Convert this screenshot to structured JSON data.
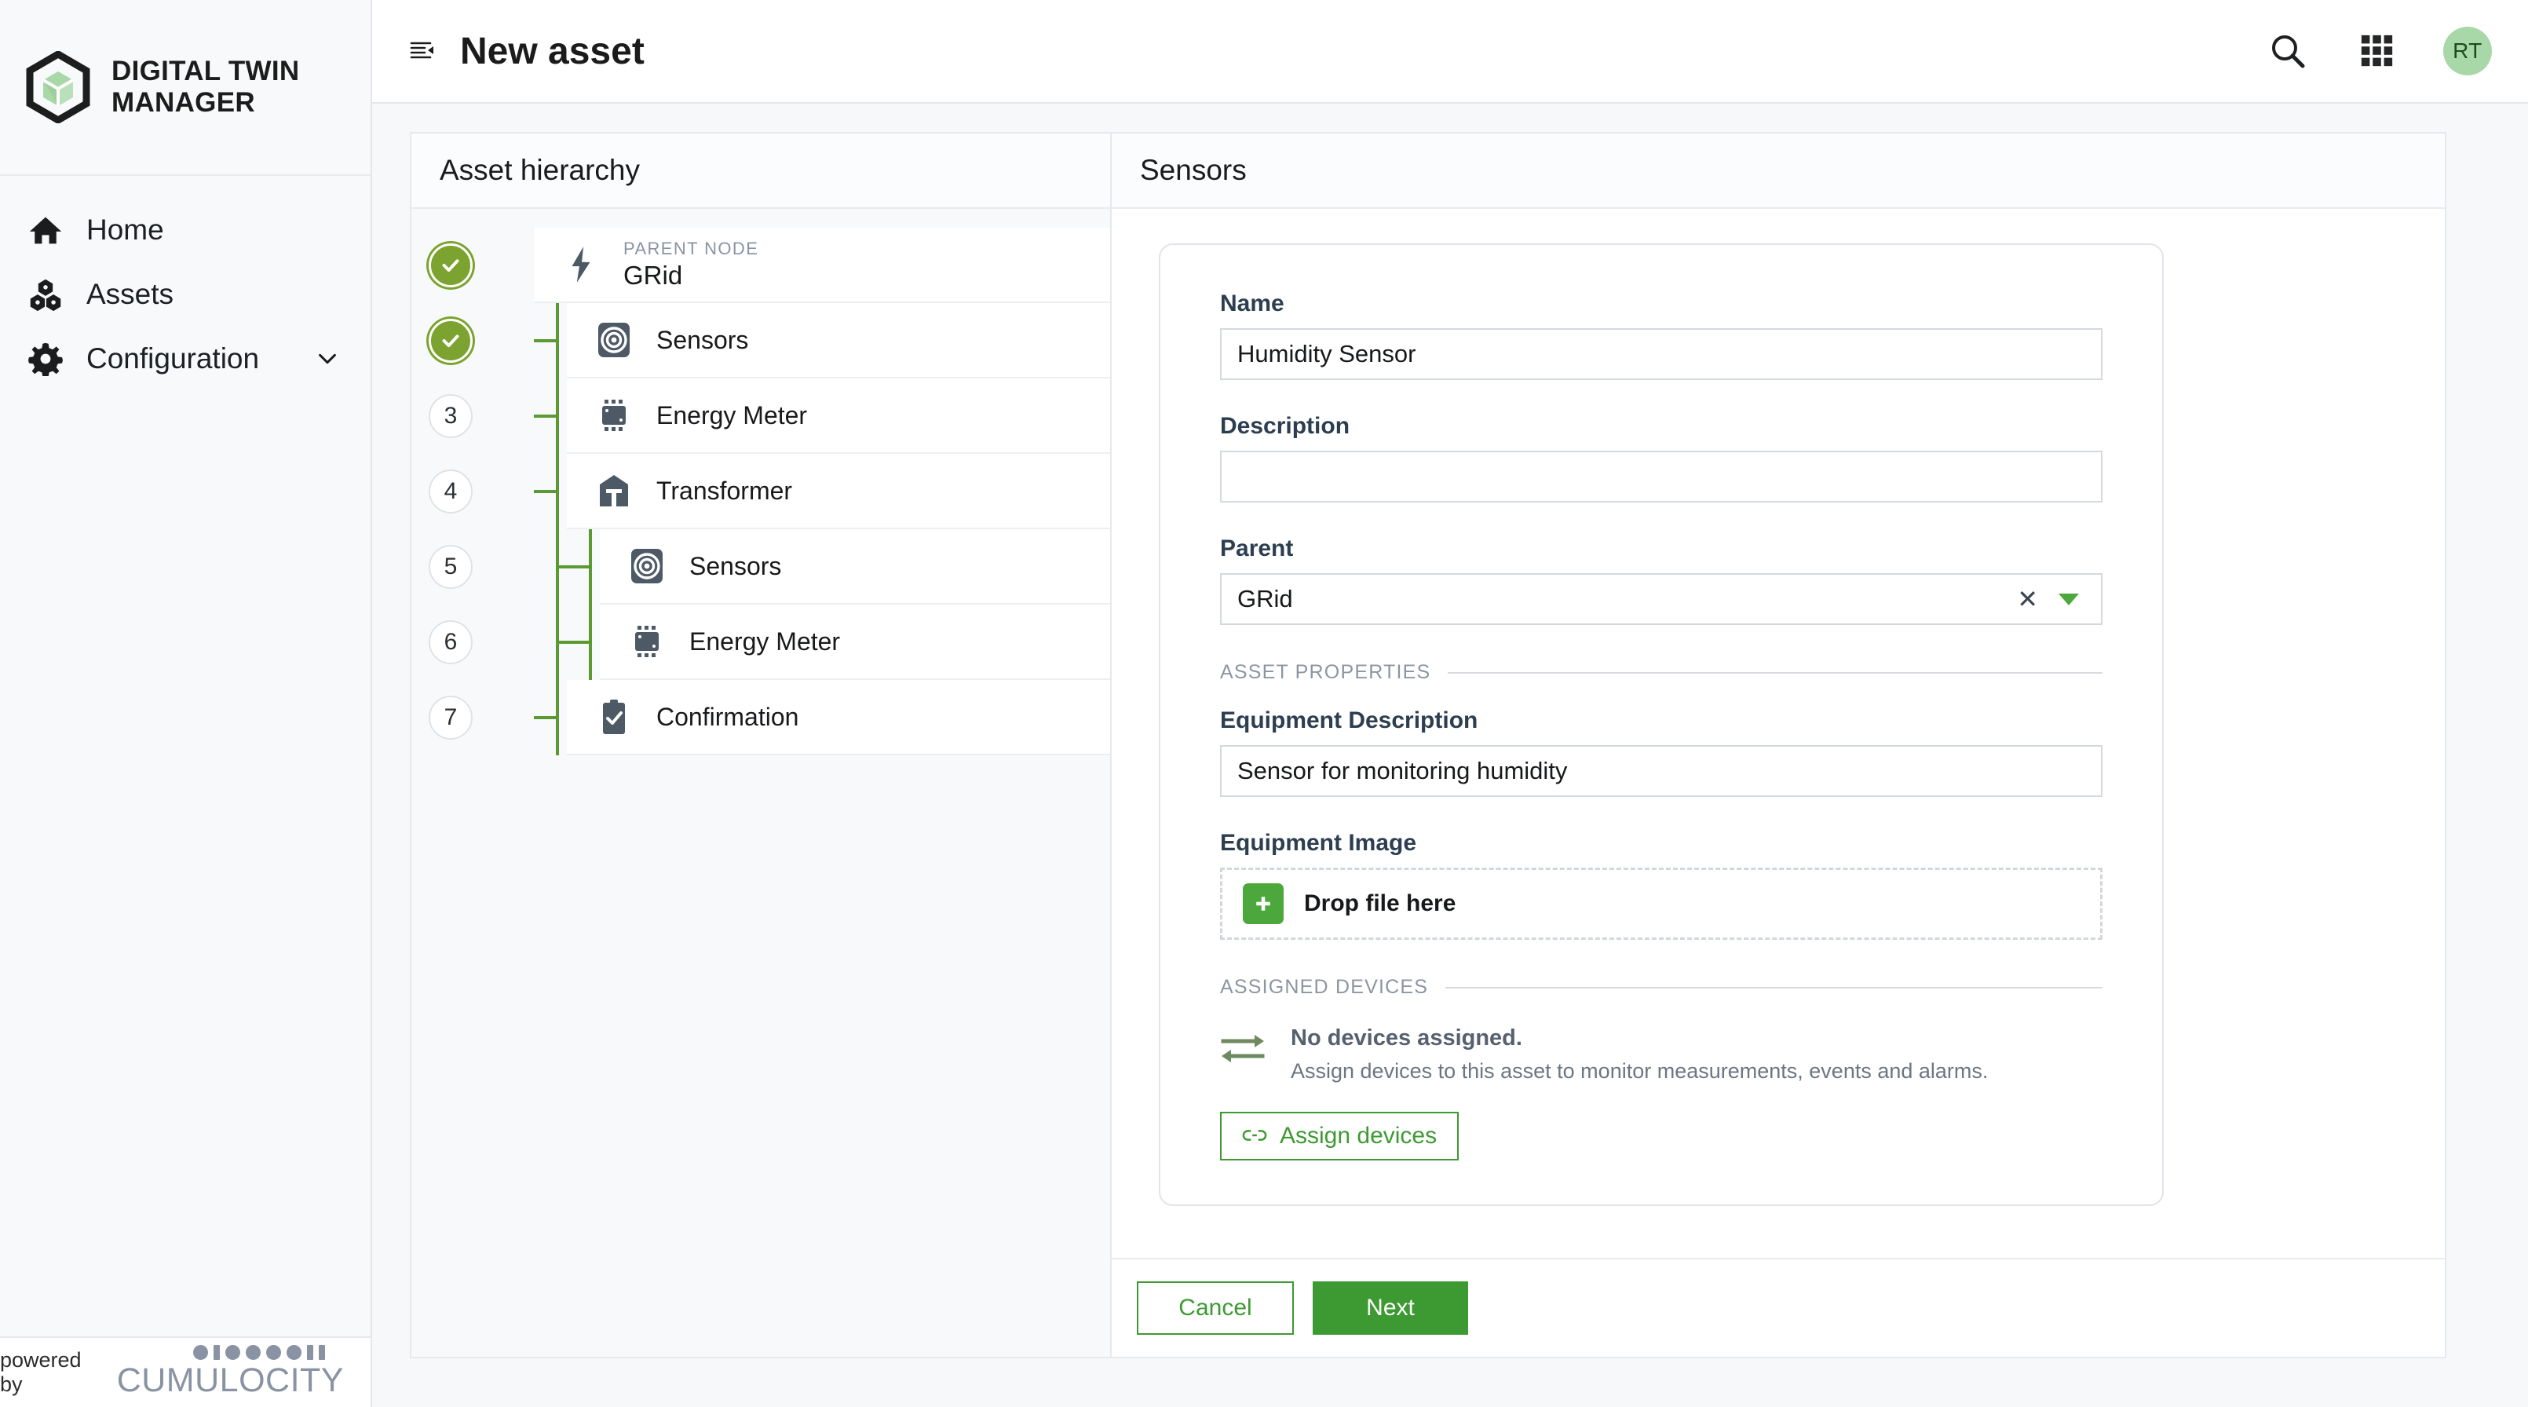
{
  "brand": {
    "line1": "DIGITAL TWIN",
    "line2": "MANAGER",
    "logo_icon": "cube-hexagon-logo"
  },
  "sidebar": {
    "items": [
      {
        "label": "Home",
        "icon": "home-icon"
      },
      {
        "label": "Assets",
        "icon": "cubes-icon"
      },
      {
        "label": "Configuration",
        "icon": "gear-icon",
        "caret": "chevron-down-icon"
      }
    ],
    "footer": {
      "powered_by": "powered by",
      "product": "CUMULOCITY"
    }
  },
  "topbar": {
    "menu_icon": "collapse-menu-icon",
    "title": "New asset",
    "search_icon": "search-icon",
    "apps_icon": "app-grid-icon",
    "avatar_initials": "RT"
  },
  "hierarchy": {
    "title": "Asset hierarchy",
    "nodes": [
      {
        "step": "1",
        "done": true,
        "indent": 0,
        "icon": "bolt-icon",
        "tag": "PARENT NODE",
        "label": "GRid"
      },
      {
        "step": "2",
        "done": true,
        "indent": 0,
        "icon": "target-icon",
        "tag": "",
        "label": "Sensors"
      },
      {
        "step": "3",
        "done": false,
        "indent": 0,
        "icon": "microchip-icon",
        "tag": "",
        "label": "Energy Meter"
      },
      {
        "step": "4",
        "done": false,
        "indent": 0,
        "icon": "transformer-icon",
        "tag": "",
        "label": "Transformer"
      },
      {
        "step": "5",
        "done": false,
        "indent": 1,
        "icon": "target-icon",
        "tag": "",
        "label": "Sensors"
      },
      {
        "step": "6",
        "done": false,
        "indent": 1,
        "icon": "microchip-icon",
        "tag": "",
        "label": "Energy Meter"
      },
      {
        "step": "7",
        "done": false,
        "indent": 0,
        "icon": "clipboard-check-icon",
        "tag": "",
        "label": "Confirmation"
      }
    ]
  },
  "form": {
    "title": "Sensors",
    "name": {
      "label": "Name",
      "value": "Humidity Sensor"
    },
    "description": {
      "label": "Description",
      "value": ""
    },
    "parent": {
      "label": "Parent",
      "value": "GRid",
      "clear_icon": "close-icon",
      "caret_icon": "caret-down-icon"
    },
    "asset_properties_legend": "ASSET PROPERTIES",
    "equipment_description": {
      "label": "Equipment Description",
      "value": "Sensor for monitoring humidity"
    },
    "equipment_image": {
      "label": "Equipment Image",
      "dropzone_label": "Drop file here",
      "plus_icon": "plus-icon"
    },
    "assigned_devices_legend": "ASSIGNED DEVICES",
    "assigned": {
      "icon": "exchange-arrows-icon",
      "title": "No devices assigned.",
      "subtitle": "Assign devices to this asset to monitor measurements, events and alarms.",
      "button_label": "Assign devices",
      "button_icon": "link-icon"
    },
    "footer": {
      "cancel": "Cancel",
      "next": "Next"
    }
  },
  "colors": {
    "accent_green": "#3d9a32",
    "step_done_green": "#7ca32f",
    "tree_line_green": "#5b9a33",
    "avatar_green": "#a8d8a8",
    "icon_slate": "#4e5966"
  }
}
